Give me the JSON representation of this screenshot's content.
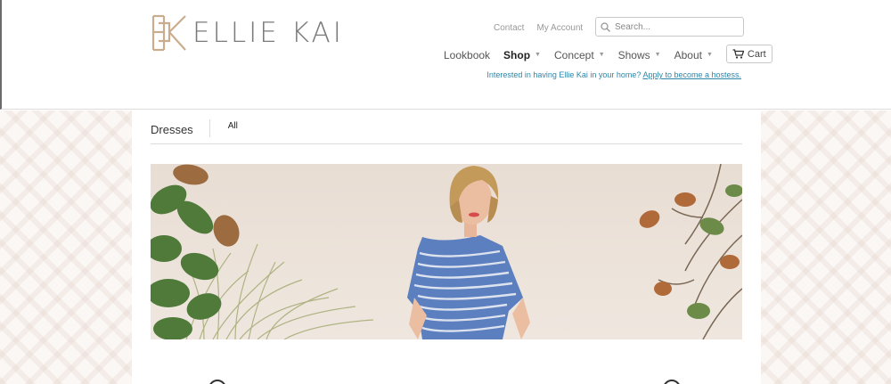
{
  "brand": {
    "name": "ELLIE KAI",
    "logo_icon": "ek-monogram-icon"
  },
  "utility_links": [
    {
      "label": "Contact"
    },
    {
      "label": "My Account"
    }
  ],
  "search": {
    "placeholder": "Search...",
    "value": "",
    "icon": "search-icon"
  },
  "nav": [
    {
      "label": "Lookbook",
      "has_dropdown": false,
      "active": false
    },
    {
      "label": "Shop",
      "has_dropdown": true,
      "active": true
    },
    {
      "label": "Concept",
      "has_dropdown": true,
      "active": false
    },
    {
      "label": "Shows",
      "has_dropdown": true,
      "active": false
    },
    {
      "label": "About",
      "has_dropdown": true,
      "active": false
    }
  ],
  "cart": {
    "label": "Cart",
    "icon": "cart-icon"
  },
  "promo": {
    "text": "Interested in having Ellie Kai in your home?",
    "link_label": "Apply to become a hostess."
  },
  "collection": {
    "title": "Dresses",
    "filter": "All"
  },
  "banner": {
    "alt": "Model in blue striped dress on beach",
    "image_icon": "banner-photo"
  },
  "colors": {
    "link": "#2f86a8",
    "logo": "#c9ad8e",
    "text": "#555555"
  }
}
